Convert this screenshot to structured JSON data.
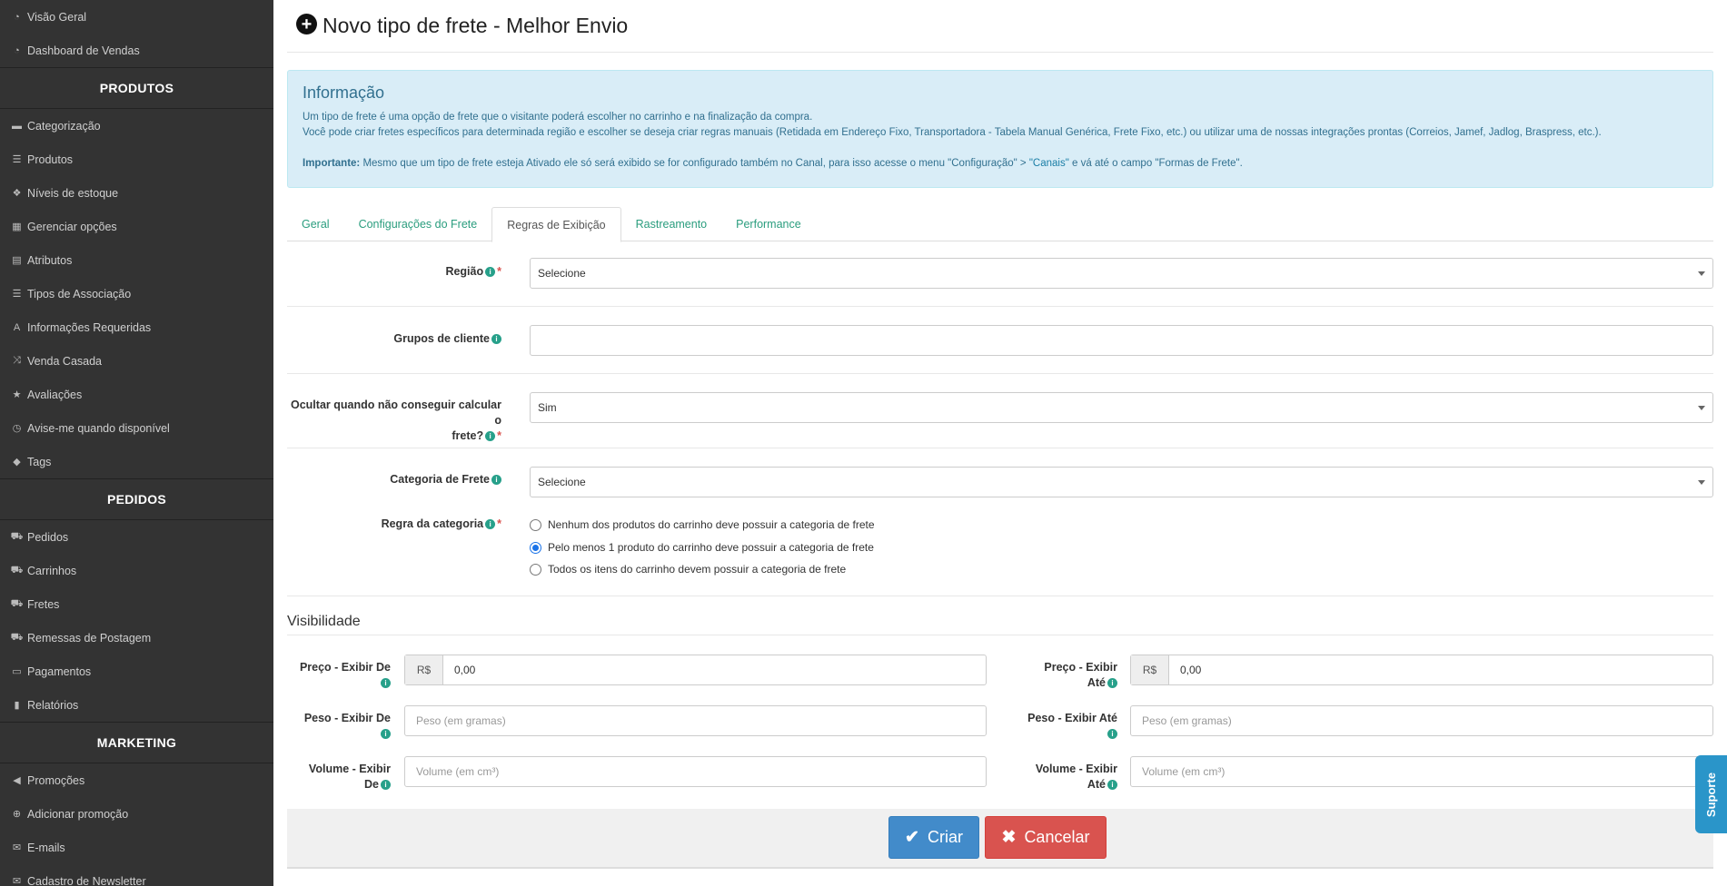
{
  "sidebar": {
    "top_items": [
      {
        "label": "Visão Geral",
        "icon": "dashboard-icon"
      },
      {
        "label": "Dashboard de Vendas",
        "icon": "dashboard-icon"
      }
    ],
    "produtos": {
      "title": "PRODUTOS",
      "items": [
        {
          "label": "Categorização",
          "icon": "folder-icon"
        },
        {
          "label": "Produtos",
          "icon": "list-icon"
        },
        {
          "label": "Níveis de estoque",
          "icon": "cubes-icon"
        },
        {
          "label": "Gerenciar opções",
          "icon": "grid-icon"
        },
        {
          "label": "Atributos",
          "icon": "list-alt-icon"
        },
        {
          "label": "Tipos de Associação",
          "icon": "list-icon"
        },
        {
          "label": "Informações Requeridas",
          "icon": "font-icon"
        },
        {
          "label": "Venda Casada",
          "icon": "random-icon"
        },
        {
          "label": "Avaliações",
          "icon": "star-icon"
        },
        {
          "label": "Avise-me quando disponível",
          "icon": "clock-icon"
        },
        {
          "label": "Tags",
          "icon": "tag-icon"
        }
      ]
    },
    "pedidos": {
      "title": "PEDIDOS",
      "items": [
        {
          "label": "Pedidos",
          "icon": "cart-icon"
        },
        {
          "label": "Carrinhos",
          "icon": "cart-icon"
        },
        {
          "label": "Fretes",
          "icon": "truck-icon"
        },
        {
          "label": "Remessas de Postagem",
          "icon": "truck-icon"
        },
        {
          "label": "Pagamentos",
          "icon": "credit-card-icon"
        },
        {
          "label": "Relatórios",
          "icon": "bar-chart-icon"
        }
      ]
    },
    "marketing": {
      "title": "MARKETING",
      "items": [
        {
          "label": "Promoções",
          "icon": "bullhorn-icon"
        },
        {
          "label": "Adicionar promoção",
          "icon": "plus-circle-icon"
        },
        {
          "label": "E-mails",
          "icon": "envelope-icon"
        },
        {
          "label": "Cadastro de Newsletter",
          "icon": "envelope-icon"
        }
      ]
    }
  },
  "header": {
    "title": "Novo tipo de frete - Melhor Envio"
  },
  "alert": {
    "title": "Informação",
    "line1": "Um tipo de frete é uma opção de frete que o visitante poderá escolher no carrinho e na finalização da compra.",
    "line2": "Você pode criar fretes específicos para determinada região e escolher se deseja criar regras manuais (Retidada em Endereço Fixo, Transportadora - Tabela Manual Genérica, Frete Fixo, etc.) ou utilizar uma de nossas integrações prontas (Correios, Jamef, Jadlog, Braspress, etc.).",
    "important_label": "Importante:",
    "important_text": " Mesmo que um tipo de frete esteja Ativado ele só será exibido se for configurado também no Canal, para isso acesse o menu \"Configuração\" > ",
    "important_link": "\"Canais\"",
    "important_tail": " e vá até o campo \"Formas de Frete\"."
  },
  "tabs": [
    "Geral",
    "Configurações do Frete",
    "Regras de Exibição",
    "Rastreamento",
    "Performance"
  ],
  "form": {
    "regiao_label": "Região",
    "regiao_value": "Selecione",
    "grupos_label": "Grupos de cliente",
    "grupos_value": "",
    "ocultar_label_1": "Ocultar quando não conseguir calcular o",
    "ocultar_label_2": "frete?",
    "ocultar_value": "Sim",
    "categoria_label": "Categoria de Frete",
    "categoria_value": "Selecione",
    "regra_label": "Regra da categoria",
    "regra_options": [
      "Nenhum dos produtos do carrinho deve possuir a categoria de frete",
      "Pelo menos 1 produto do carrinho deve possuir a categoria de frete",
      "Todos os itens do carrinho devem possuir a categoria de frete"
    ],
    "regra_selected": 1
  },
  "visibilidade": {
    "title": "Visibilidade",
    "preco_de_label_1": "Preço - Exibir De",
    "preco_ate_label_1": "Preço - Exibir",
    "preco_ate_label_2": "Até",
    "currency": "R$",
    "preco_de_value": "0,00",
    "preco_ate_value": "0,00",
    "peso_de_label": "Peso - Exibir De",
    "peso_ate_label": "Peso - Exibir Até",
    "peso_placeholder": "Peso (em gramas)",
    "volume_de_label_1": "Volume - Exibir",
    "volume_de_label_2": "De",
    "volume_ate_label_1": "Volume - Exibir",
    "volume_ate_label_2": "Até",
    "volume_placeholder": "Volume (em cm³)"
  },
  "buttons": {
    "create": "Criar",
    "cancel": "Cancelar"
  },
  "support": "Suporte"
}
